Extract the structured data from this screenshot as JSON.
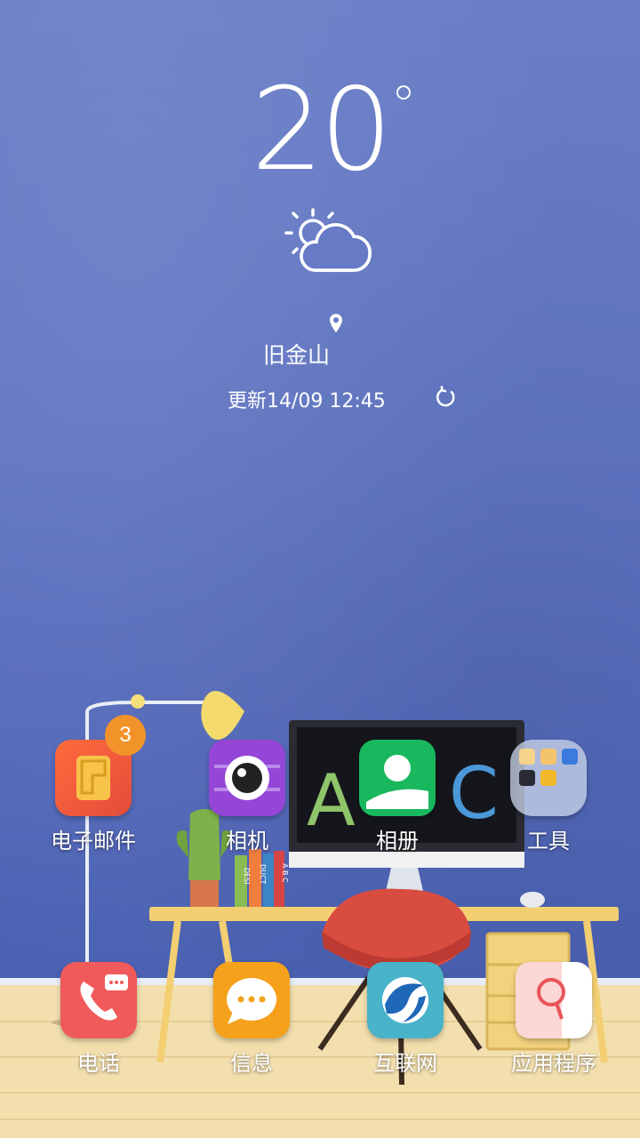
{
  "weather": {
    "temperature": "20",
    "icon": "partly-sunny-icon",
    "city": "旧金山",
    "updated": "更新14/09 12:45"
  },
  "apps": [
    {
      "label": "电子邮件",
      "icon": "email-icon",
      "badge": "3",
      "color": "#ee4f3a"
    },
    {
      "label": "相机",
      "icon": "camera-icon",
      "color": "#9546d6"
    },
    {
      "label": "相册",
      "icon": "gallery-icon",
      "color": "#19b85e"
    },
    {
      "label": "工具",
      "icon": "tools-folder-icon",
      "color": "#aab8d8"
    }
  ],
  "dock": [
    {
      "label": "电话",
      "icon": "phone-icon",
      "color": "#f05a5a"
    },
    {
      "label": "信息",
      "icon": "messages-icon",
      "color": "#f5a11c"
    },
    {
      "label": "互联网",
      "icon": "internet-icon",
      "color": "#49b3c9"
    },
    {
      "label": "应用程序",
      "icon": "apps-icon",
      "color": "#ffffff"
    }
  ],
  "monitor_letters": [
    "A",
    "C"
  ],
  "book_spines": [
    "DESI",
    "DUCT",
    "A B C"
  ]
}
